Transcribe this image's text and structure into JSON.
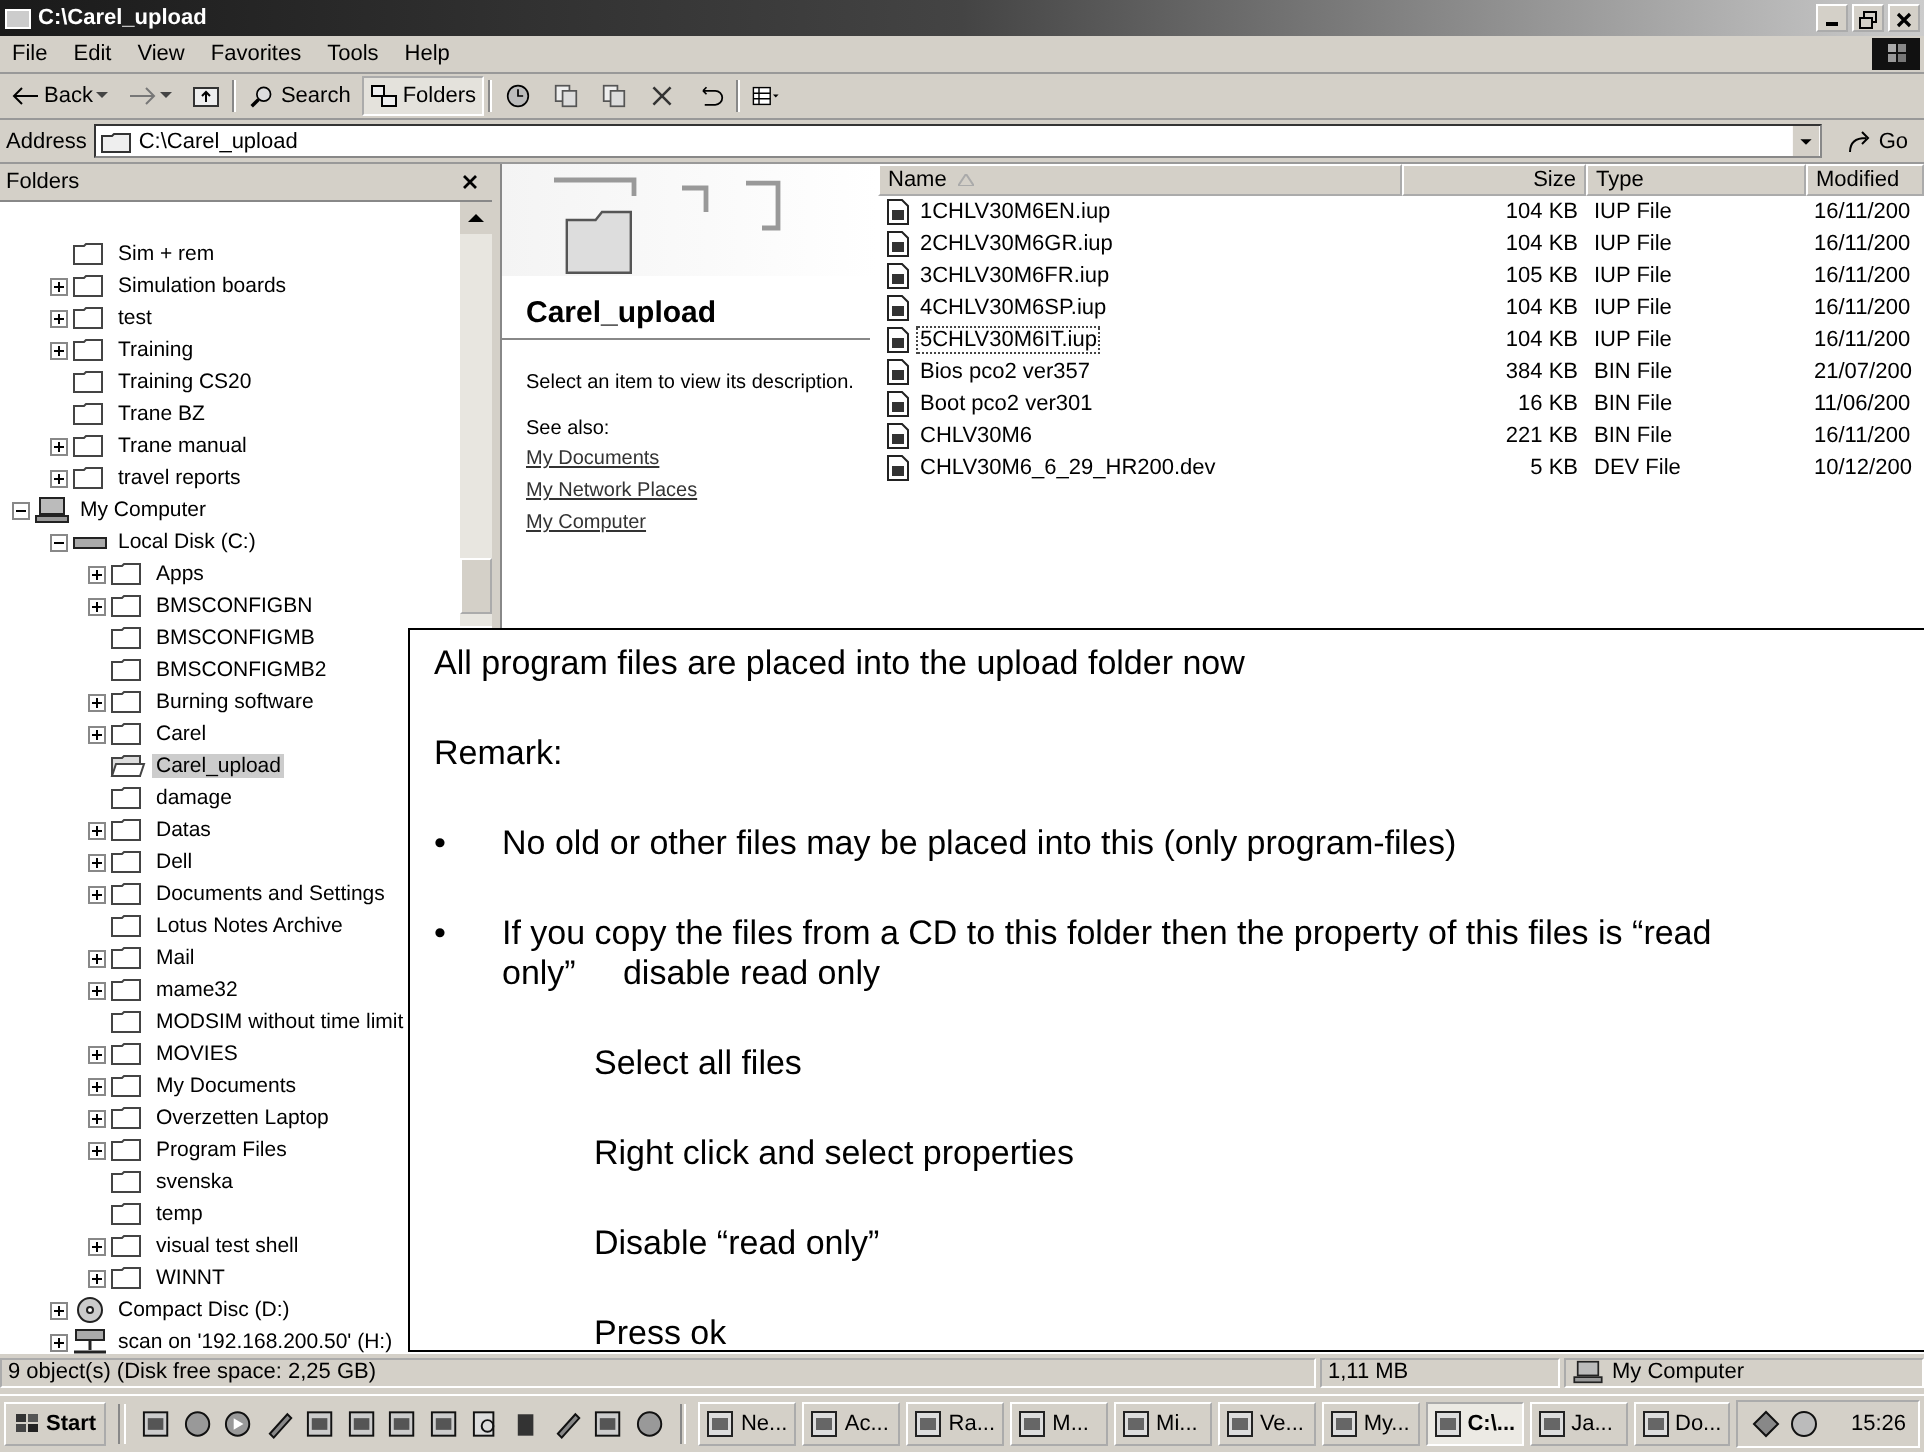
{
  "window": {
    "title": "C:\\Carel_upload"
  },
  "menu": [
    "File",
    "Edit",
    "View",
    "Favorites",
    "Tools",
    "Help"
  ],
  "toolbar": [
    {
      "kind": "back",
      "label": "Back",
      "selected": false
    },
    {
      "kind": "forward",
      "selected": false
    },
    {
      "kind": "up",
      "selected": false
    },
    {
      "kind": "search",
      "label": "Search",
      "selected": false
    },
    {
      "kind": "folders",
      "label": "Folders",
      "selected": true
    },
    {
      "kind": "history",
      "selected": false
    },
    {
      "kind": "move",
      "selected": false
    },
    {
      "kind": "copy",
      "selected": false
    },
    {
      "kind": "delete",
      "selected": false
    },
    {
      "kind": "undo",
      "selected": false
    },
    {
      "kind": "views",
      "selected": false
    }
  ],
  "address": {
    "label": "Address",
    "value": "C:\\Carel_upload",
    "go": "Go"
  },
  "folders_pane": {
    "title": "Folders",
    "upper_items": [
      {
        "label": "Sim + rem",
        "expandable": false,
        "selected": false
      },
      {
        "label": "Simulation boards",
        "expandable": true,
        "selected": false
      },
      {
        "label": "test",
        "expandable": true,
        "selected": false
      },
      {
        "label": "Training",
        "expandable": true,
        "selected": false
      },
      {
        "label": "Training CS20",
        "expandable": false,
        "selected": false
      },
      {
        "label": "Trane BZ",
        "expandable": false,
        "selected": false
      },
      {
        "label": "Trane manual",
        "expandable": true,
        "selected": false
      },
      {
        "label": "travel reports",
        "expandable": true,
        "selected": false
      }
    ],
    "tree": [
      {
        "label": "My Computer",
        "kind": "computer",
        "expandable": true,
        "expanded": true,
        "selected": false,
        "children": [
          {
            "label": "Local Disk (C:)",
            "kind": "drive",
            "expandable": true,
            "expanded": true,
            "selected": false,
            "children": [
              {
                "label": "Apps",
                "kind": "folder",
                "expandable": true,
                "expanded": false,
                "selected": false
              },
              {
                "label": "BMSCONFIGBN",
                "kind": "folder",
                "expandable": true,
                "expanded": false,
                "selected": false
              },
              {
                "label": "BMSCONFIGMB",
                "kind": "folder",
                "expandable": false,
                "expanded": false,
                "selected": false
              },
              {
                "label": "BMSCONFIGMB2",
                "kind": "folder",
                "expandable": false,
                "expanded": false,
                "selected": false
              },
              {
                "label": "Burning software",
                "kind": "folder",
                "expandable": true,
                "expanded": false,
                "selected": false
              },
              {
                "label": "Carel",
                "kind": "folder",
                "expandable": true,
                "expanded": false,
                "selected": false
              },
              {
                "label": "Carel_upload",
                "kind": "folder",
                "expandable": false,
                "expanded": false,
                "selected": true
              },
              {
                "label": "damage",
                "kind": "folder",
                "expandable": false,
                "expanded": false,
                "selected": false
              },
              {
                "label": "Datas",
                "kind": "folder",
                "expandable": true,
                "expanded": false,
                "selected": false
              },
              {
                "label": "Dell",
                "kind": "folder",
                "expandable": true,
                "expanded": false,
                "selected": false
              },
              {
                "label": "Documents and Settings",
                "kind": "folder",
                "expandable": true,
                "expanded": false,
                "selected": false
              },
              {
                "label": "Lotus Notes Archive",
                "kind": "folder",
                "expandable": false,
                "expanded": false,
                "selected": false
              },
              {
                "label": "Mail",
                "kind": "folder",
                "expandable": true,
                "expanded": false,
                "selected": false
              },
              {
                "label": "mame32",
                "kind": "folder",
                "expandable": true,
                "expanded": false,
                "selected": false
              },
              {
                "label": "MODSIM without time limit",
                "kind": "folder",
                "expandable": false,
                "expanded": false,
                "selected": false
              },
              {
                "label": "MOVIES",
                "kind": "folder",
                "expandable": true,
                "expanded": false,
                "selected": false
              },
              {
                "label": "My Documents",
                "kind": "folder",
                "expandable": true,
                "expanded": false,
                "selected": false
              },
              {
                "label": "Overzetten Laptop",
                "kind": "folder",
                "expandable": true,
                "expanded": false,
                "selected": false
              },
              {
                "label": "Program Files",
                "kind": "folder",
                "expandable": true,
                "expanded": false,
                "selected": false
              },
              {
                "label": "svenska",
                "kind": "folder",
                "expandable": false,
                "expanded": false,
                "selected": false
              },
              {
                "label": "temp",
                "kind": "folder",
                "expandable": false,
                "expanded": false,
                "selected": false
              },
              {
                "label": "visual test shell",
                "kind": "folder",
                "expandable": true,
                "expanded": false,
                "selected": false
              },
              {
                "label": "WINNT",
                "kind": "folder",
                "expandable": true,
                "expanded": false,
                "selected": false
              }
            ]
          },
          {
            "label": "Compact Disc (D:)",
            "kind": "cd",
            "expandable": true,
            "expanded": false,
            "selected": false
          },
          {
            "label": "scan on '192.168.200.50' (H:)",
            "kind": "network",
            "expandable": true,
            "expanded": false,
            "selected": false
          }
        ]
      }
    ]
  },
  "info_panel": {
    "title": "Carel_upload",
    "description": "Select an item to view its description.",
    "see_also": "See also:",
    "links": [
      "My Documents",
      "My Network Places",
      "My Computer"
    ]
  },
  "file_list": {
    "columns": [
      "Name",
      "Size",
      "Type",
      "Modified"
    ],
    "rows": [
      {
        "name": "1CHLV30M6EN.iup",
        "size": "104 KB",
        "type": "IUP File",
        "modified": "16/11/200",
        "focused": false
      },
      {
        "name": "2CHLV30M6GR.iup",
        "size": "104 KB",
        "type": "IUP File",
        "modified": "16/11/200",
        "focused": false
      },
      {
        "name": "3CHLV30M6FR.iup",
        "size": "105 KB",
        "type": "IUP File",
        "modified": "16/11/200",
        "focused": false
      },
      {
        "name": "4CHLV30M6SP.iup",
        "size": "104 KB",
        "type": "IUP File",
        "modified": "16/11/200",
        "focused": false
      },
      {
        "name": "5CHLV30M6IT.iup",
        "size": "104 KB",
        "type": "IUP File",
        "modified": "16/11/200",
        "focused": true
      },
      {
        "name": "Bios pco2 ver357",
        "size": "384 KB",
        "type": "BIN File",
        "modified": "21/07/200",
        "focused": false
      },
      {
        "name": "Boot pco2 ver301",
        "size": "16 KB",
        "type": "BIN File",
        "modified": "11/06/200",
        "focused": false
      },
      {
        "name": "CHLV30M6",
        "size": "221 KB",
        "type": "BIN File",
        "modified": "16/11/200",
        "focused": false
      },
      {
        "name": "CHLV30M6_6_29_HR200.dev",
        "size": "5 KB",
        "type": "DEV File",
        "modified": "10/12/200",
        "focused": false
      }
    ]
  },
  "note": [
    {
      "kind": "text",
      "text": "All program files are placed into the upload folder now"
    },
    {
      "kind": "text",
      "text": "Remark:"
    },
    {
      "kind": "bullet",
      "bullet": "•",
      "text": "No old or other files may be placed into this (only program-files)"
    },
    {
      "kind": "bullet",
      "bullet": "•",
      "text": "If you copy the files from a CD to this folder then the property of this files is “read only”     disable read only"
    },
    {
      "kind": "step",
      "text": "Select all files"
    },
    {
      "kind": "step",
      "text": "Right click and select properties"
    },
    {
      "kind": "step",
      "text": "Disable “read only”"
    },
    {
      "kind": "step",
      "text": "Press ok"
    }
  ],
  "status_bar": {
    "objects": "9 object(s) (Disk free space: 2,25 GB)",
    "size": "1,11 MB",
    "zone": "My Computer"
  },
  "taskbar": {
    "start": "Start",
    "tasks": [
      {
        "label": "Ne...",
        "selected": false
      },
      {
        "label": "Ac...",
        "selected": false
      },
      {
        "label": "Ra...",
        "selected": false
      },
      {
        "label": "M...",
        "selected": false
      },
      {
        "label": "Mi...",
        "selected": false
      },
      {
        "label": "Ve...",
        "selected": false
      },
      {
        "label": "My...",
        "selected": false
      },
      {
        "label": "C:\\...",
        "selected": true
      },
      {
        "label": "Ja...",
        "selected": false
      },
      {
        "label": "Do...",
        "selected": false
      }
    ],
    "clock": "15:26"
  }
}
